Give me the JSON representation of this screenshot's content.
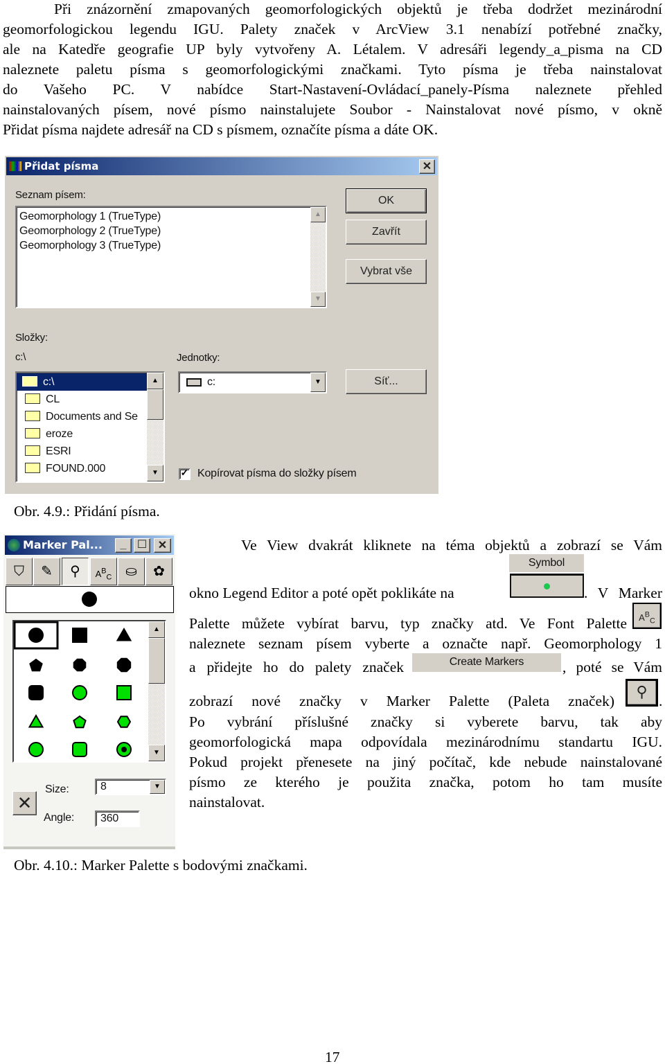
{
  "paragraph1": [
    "Při znázornění zmapovaných geomorfologických objektů je třeba dodržet mezinárodní",
    "geomorfologickou legendu IGU. Palety značek v ArcView 3.1 nenabízí potřebné značky,",
    "ale na Katedře geografie UP byly vytvořeny A. Létalem. V adresáři legendy_a_pisma na CD",
    "naleznete paletu písma s geomorfologickými značkami. Tyto písma je třeba nainstalovat",
    "do Vašeho PC. V nabídce Start-Nastavení-Ovládací_panely-Písma naleznete přehled",
    "nainstalovaných písem, nové písmo nainstalujete Soubor - Nainstalovat nové písmo, v okně",
    "Přidat písma najdete adresář na CD s písmem, označíte písma a dáte OK."
  ],
  "dialog": {
    "title": "Přidat písma",
    "fonts_label": "Seznam písem:",
    "fonts": [
      "Geomorphology 1 (TrueType)",
      "Geomorphology 2  (TrueType)",
      "Geomorphology 3 (TrueType)"
    ],
    "ok": "OK",
    "close": "Zavřít",
    "select_all": "Vybrat vše",
    "folders_label": "Složky:",
    "current_path": "c:\\",
    "folders": [
      "c:\\",
      "CL",
      "Documents and Se",
      "eroze",
      "ESRI",
      "FOUND.000"
    ],
    "drives_label": "Jednotky:",
    "drive": "c:",
    "network": "Síť...",
    "copy_checkbox": "Kopírovat písma do složky písem",
    "copy_checked": true
  },
  "caption1": "Obr. 4.9.: Přidání písma.",
  "palette": {
    "title": "Marker Pal...",
    "toolbar": [
      "fill-icon",
      "pen-icon",
      "marker-icon",
      "font-icon",
      "brush-icon",
      "color-palette-icon"
    ],
    "markers": [
      {
        "shape": "circle",
        "fill": "#000000",
        "selected": true
      },
      {
        "shape": "square",
        "fill": "#000000"
      },
      {
        "shape": "triangle",
        "fill": "#000000"
      },
      {
        "shape": "pentagon",
        "fill": "#000000"
      },
      {
        "shape": "octagon-small",
        "fill": "#000000"
      },
      {
        "shape": "octagon",
        "fill": "#000000"
      },
      {
        "shape": "rounded-square",
        "fill": "#000000"
      },
      {
        "shape": "circle",
        "fill": "#00e000"
      },
      {
        "shape": "square",
        "fill": "#00e000"
      },
      {
        "shape": "triangle",
        "fill": "#00e000"
      },
      {
        "shape": "pentagon",
        "fill": "#00e000"
      },
      {
        "shape": "hexagon",
        "fill": "#00e000"
      },
      {
        "shape": "circle-large",
        "fill": "#00e000"
      },
      {
        "shape": "rounded-square",
        "fill": "#00e000"
      },
      {
        "shape": "ring-dot",
        "fill": "#00e000"
      }
    ],
    "size_label": "Size:",
    "size": "8",
    "angle_label": "Angle:",
    "angle": "360"
  },
  "caption2": "Obr. 4.10.: Marker Palette s bodovými značkami.",
  "paragraph2": {
    "l1": "Ve View dvakrát kliknete na téma objektů a zobrazí se Vám",
    "l2a": "okno Legend Editor a poté opět poklikáte na",
    "l2b": ". V Marker",
    "symbol_header": "Symbol",
    "symbol_color": "#1ec850",
    "l3": "Palette můžete vybírat barvu, typ značky atd. Ve Font Palette",
    "l4": "naleznete seznam písem vyberte a označte např. Geomorphology 1",
    "l5a": "a přidejte ho do palety značek",
    "create_markers": "Create Markers",
    "l5b": ", poté se Vám",
    "l6a": "zobrazí nové značky v Marker Palette (Paleta značek)",
    "l6b": ".",
    "l7": "Po vybrání příslušné značky si vyberete barvu, tak aby",
    "l8": "geomorfologická mapa odpovídala mezinárodnímu standartu IGU.",
    "l9": "Pokud projekt přenesete na jiný počítač, kde nebude nainstalované",
    "l10": "písmo ze kterého je použita značka, potom ho tam musíte",
    "l11": "nainstalovat."
  },
  "page_number": "17"
}
